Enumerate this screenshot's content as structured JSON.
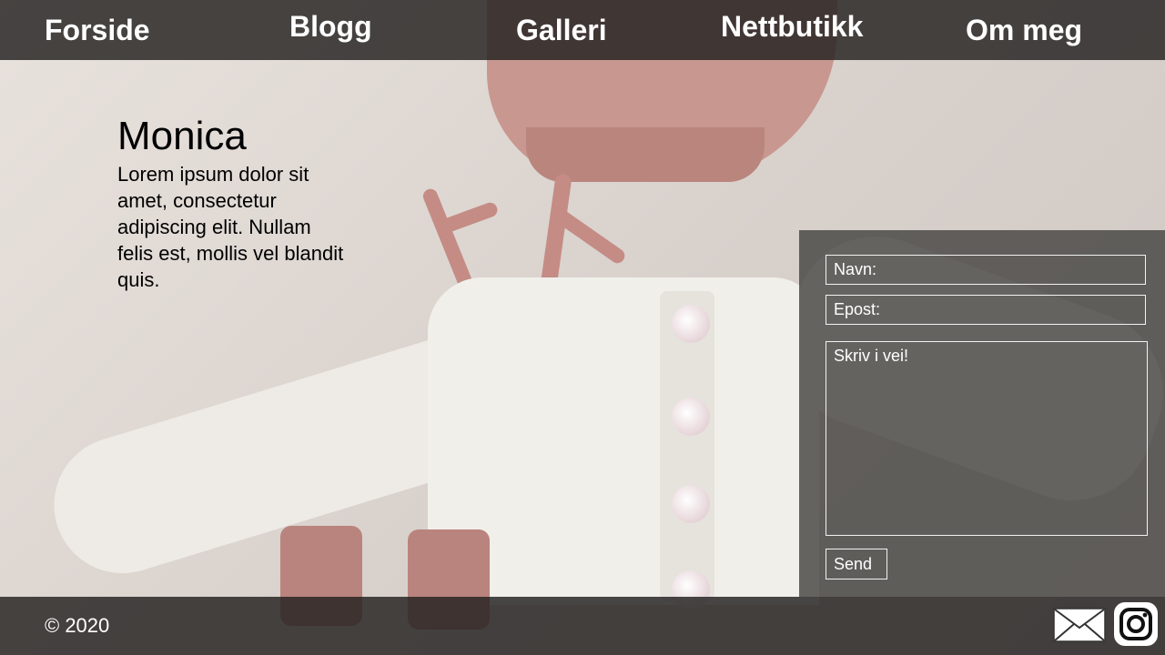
{
  "nav": {
    "items": [
      {
        "label": "Forside"
      },
      {
        "label": "Blogg"
      },
      {
        "label": "Galleri"
      },
      {
        "label": "Nettbutikk"
      },
      {
        "label": "Om meg"
      }
    ]
  },
  "intro": {
    "title": "Monica",
    "body": "Lorem ipsum dolor sit amet, consectetur adipiscing elit. Nullam felis est, mollis vel blandit quis."
  },
  "contact": {
    "name_placeholder": "Navn:",
    "email_placeholder": "Epost:",
    "message_placeholder": "Skriv i vei!",
    "send_label": "Send"
  },
  "footer": {
    "copyright": "© 2020",
    "icons": [
      "mail-icon",
      "instagram-icon"
    ]
  },
  "colors": {
    "bar": "#262422",
    "panel": "#464442",
    "text_light": "#ffffff",
    "text_dark": "#000000"
  }
}
